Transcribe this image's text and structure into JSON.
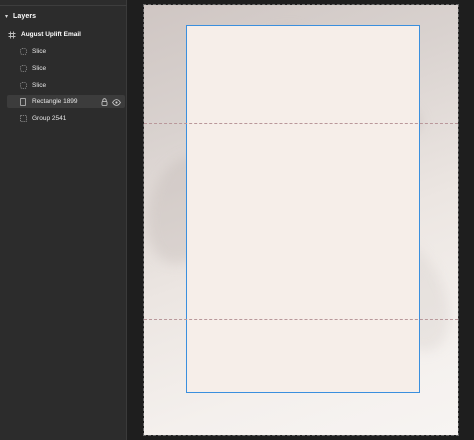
{
  "layers_panel": {
    "title": "Layers",
    "items": [
      {
        "label": "August Uplift Email",
        "icon": "frame-grid-icon"
      },
      {
        "label": "Slice",
        "icon": "slice-icon"
      },
      {
        "label": "Slice",
        "icon": "slice-icon"
      },
      {
        "label": "Slice",
        "icon": "slice-icon"
      },
      {
        "label": "Rectangle 1899",
        "icon": "rectangle-icon",
        "selected": true
      },
      {
        "label": "Group 2541",
        "icon": "group-icon"
      }
    ]
  },
  "colors": {
    "panel_bg": "#2c2c2c",
    "canvas_bg": "#1e1e1e",
    "selection": "#3a8fde",
    "guide": "#b9979a"
  }
}
